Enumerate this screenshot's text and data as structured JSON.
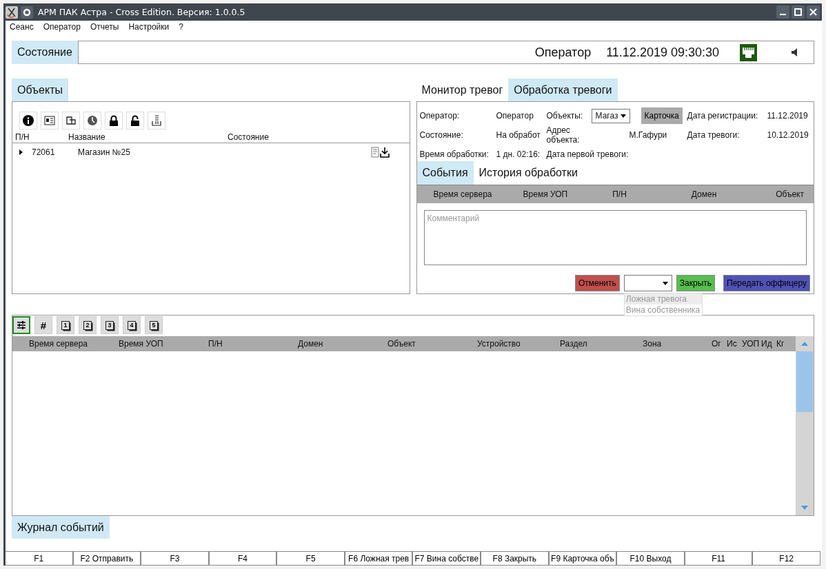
{
  "window": {
    "title": "АРМ ПАК Астра - Cross Edition. Версия: 1.0.0.5"
  },
  "menu": [
    "Сеанс",
    "Оператор",
    "Отчеты",
    "Настройки",
    "?"
  ],
  "status_bar": {
    "label": "Состояние",
    "operator": "Оператор",
    "datetime": "11.12.2019 09:30:30"
  },
  "objects_panel": {
    "tab": "Объекты",
    "columns": [
      "П/Н",
      "Название",
      "Состояние"
    ],
    "rows": [
      {
        "number": "72061",
        "name": "Магазин №25",
        "expanded": false
      }
    ]
  },
  "alarm_tabs": [
    {
      "label": "Монитор тревог",
      "selected": false
    },
    {
      "label": "Обработка тревоги",
      "selected": true
    }
  ],
  "alarm_info": {
    "operator_label": "Оператор:",
    "operator_value": "Оператор",
    "objects_label": "Объекты:",
    "objects_select": "Магаз",
    "card_button": "Карточка",
    "reg_date_label": "Дата регистрации:",
    "reg_date_value": "11.12.2019",
    "state_label": "Состояние:",
    "state_value": "На обработ",
    "address_label": "Адрес объекта:",
    "address_value": "М.Гафури",
    "alarm_date_label": "Дата тревоги:",
    "alarm_date_value": "10.12.2019",
    "time_label": "Время обработки:",
    "time_value": "1 дн. 02:16:",
    "first_alarm_label": "Дата первой тревоги:"
  },
  "sub_tabs": [
    {
      "label": "События",
      "selected": true
    },
    {
      "label": "История обработки",
      "selected": false
    }
  ],
  "events_columns": [
    "Время сервера",
    "Время УОП",
    "П/Н",
    "Домен",
    "Объект"
  ],
  "comment": {
    "placeholder": "Комментарий"
  },
  "actions": {
    "cancel": "Отменить",
    "close": "Закрыть",
    "transfer": "Передать оффицеру"
  },
  "reason_options": [
    {
      "label": "Ложная тревога",
      "selected": true
    },
    {
      "label": "Вина собственника",
      "selected": false
    }
  ],
  "journal_toolbar": [
    {
      "kind": "settings",
      "selected": true
    },
    {
      "kind": "text",
      "label": "#",
      "selected": false
    },
    {
      "kind": "page",
      "label": "1",
      "selected": false
    },
    {
      "kind": "page",
      "label": "2",
      "selected": false
    },
    {
      "kind": "page",
      "label": "3",
      "selected": false
    },
    {
      "kind": "page",
      "label": "4",
      "selected": false
    },
    {
      "kind": "page",
      "label": "5",
      "selected": false
    }
  ],
  "journal_columns": [
    "Время сервера",
    "Время УОП",
    "П/Н",
    "Домен",
    "Объект",
    "Устройство",
    "Раздел",
    "Зона",
    "Ог",
    "Ис",
    "УОП",
    "Ид",
    "Кг"
  ],
  "journal_tab": "Журнал событий",
  "function_keys": [
    "F1",
    "F2 Отправить",
    "F3",
    "F4",
    "F5",
    "F6 Ложная трев",
    "F7 Вина собстве",
    "F8 Закрыть",
    "F9 Карточка объ",
    "F10 Выход",
    "F11",
    "F12"
  ]
}
